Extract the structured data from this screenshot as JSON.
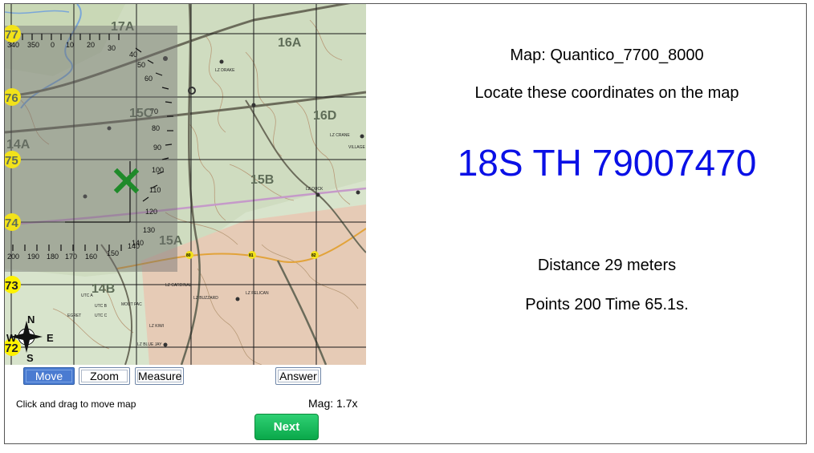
{
  "map": {
    "grid_labels": [
      "17A",
      "16A",
      "15C",
      "16D",
      "14A",
      "15B",
      "15A",
      "14B"
    ],
    "northing_labels": [
      "77",
      "76",
      "75",
      "74",
      "73",
      "72"
    ],
    "compass": {
      "n": "N",
      "s": "S",
      "e": "E",
      "w": "W"
    },
    "protractor_top": [
      "340",
      "350",
      "0",
      "10",
      "20",
      "30",
      "40",
      "50",
      "60",
      "70",
      "80",
      "90",
      "100",
      "110",
      "120",
      "130",
      "140"
    ],
    "protractor_bottom": [
      "200",
      "190",
      "180",
      "170",
      "160",
      "150",
      "140"
    ],
    "place_labels": [
      "LZ DRAKE",
      "LZ DUCK",
      "LZ CRANE",
      "VILLAGE",
      "LZ BUZZARD",
      "LZ PELICAN",
      "LZ CARDINAL",
      "LZ KIWI",
      "LZ BLUE JAY",
      "MOUT FAC",
      "UTC A",
      "UTC B",
      "UTC C",
      "EGRET"
    ],
    "road_markers": [
      "80",
      "81",
      "82"
    ],
    "marker_icon": "x-marker-icon"
  },
  "toolbar": {
    "move_label": "Move",
    "zoom_label": "Zoom",
    "measure_label": "Measure",
    "answer_label": "Answer",
    "active_tool": "Move"
  },
  "status": {
    "hint": "Click and drag to move map",
    "magnification": "Mag: 1.7x"
  },
  "next_label": "Next",
  "info": {
    "map_name": "Map: Quantico_7700_8000",
    "prompt": "Locate these coordinates on the map",
    "coordinates": "18S TH 79007470",
    "distance": "Distance 29 meters",
    "score": "Points 200 Time 65.1s."
  },
  "colors": {
    "coordinate_text": "#0a10e6",
    "active_button": "#4a7bd1",
    "next_button": "#0aa84a",
    "marker": "#1f8a2a"
  }
}
